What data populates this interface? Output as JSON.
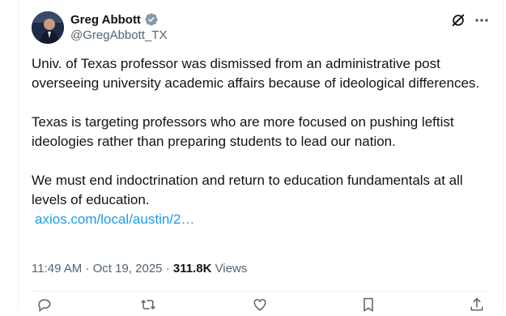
{
  "author": {
    "display_name": "Greg Abbott",
    "handle": "@GregAbbott_TX",
    "verified_icon": "verified-badge-icon"
  },
  "post": {
    "paragraphs": [
      "Univ. of Texas professor was dismissed from an administrative post overseeing university academic affairs because of ideological differences.",
      "Texas is targeting professors who are more focused on pushing leftist ideologies rather than preparing students to lead our nation.",
      "We must end indoctrination and return to education fundamentals at all levels of education."
    ],
    "link": "axios.com/local/austin/2…"
  },
  "meta": {
    "time": "11:49 AM",
    "date": "Oct 19, 2025",
    "views_count": "311.8K",
    "views_label": "Views"
  },
  "colors": {
    "link": "#1d9bf0",
    "verified": "#829aab",
    "secondary_text": "#536471"
  },
  "icons": {
    "grok": "grok-icon",
    "more": "more-icon",
    "reply": "reply-icon",
    "repost": "repost-icon",
    "like": "like-icon",
    "bookmark": "bookmark-icon",
    "share": "share-icon"
  }
}
